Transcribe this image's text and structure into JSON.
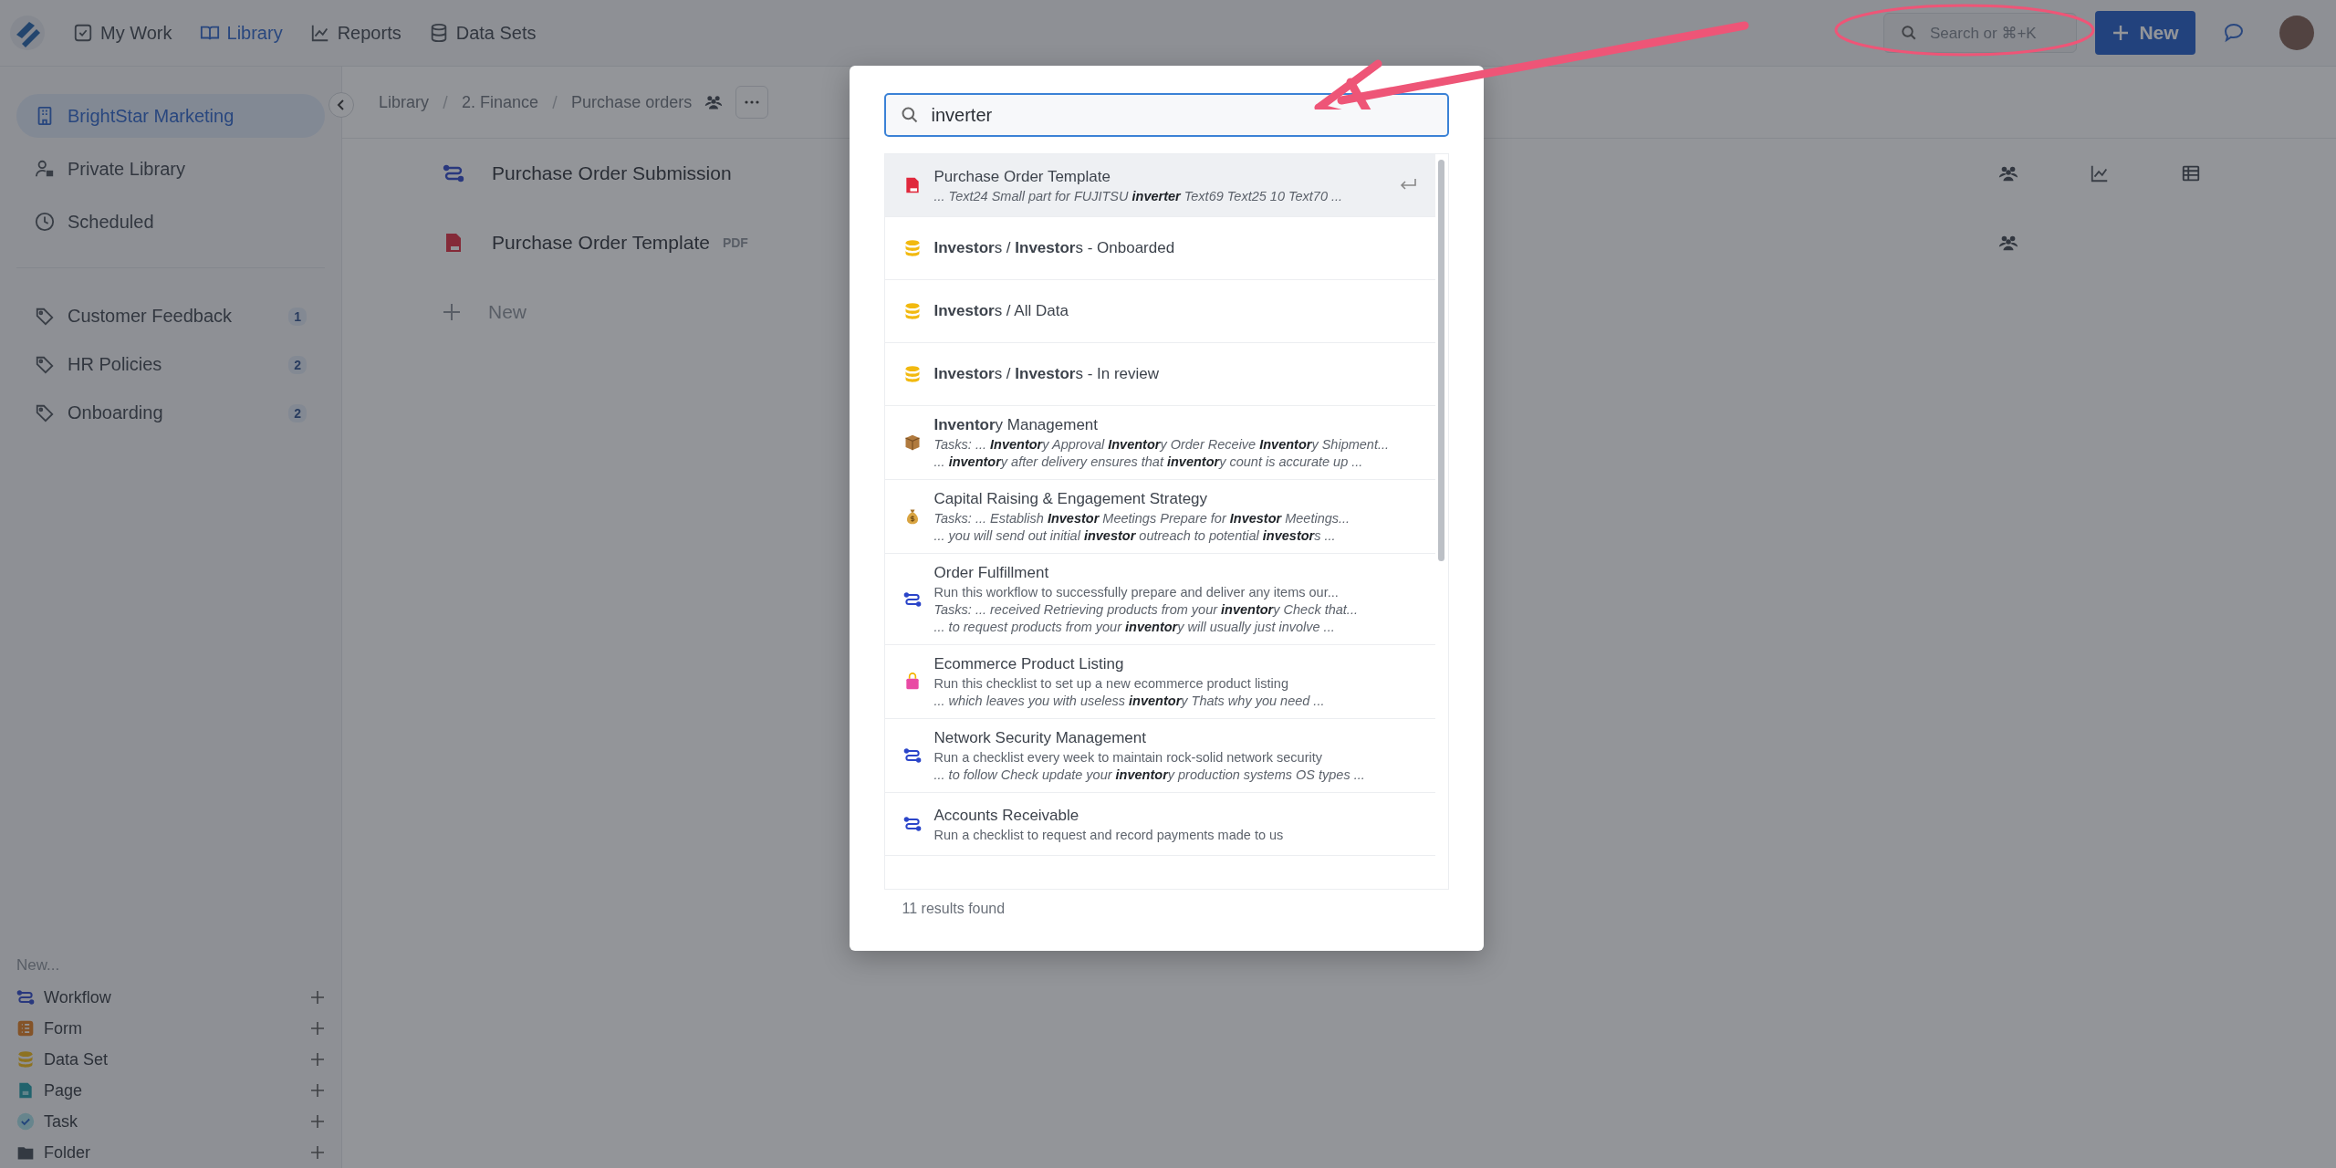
{
  "topnav": {
    "items": [
      {
        "label": "My Work",
        "kind": "check",
        "selected": false
      },
      {
        "label": "Library",
        "kind": "book",
        "selected": true
      },
      {
        "label": "Reports",
        "kind": "chart",
        "selected": false
      },
      {
        "label": "Data Sets",
        "kind": "database",
        "selected": false
      }
    ],
    "search": {
      "placeholder": "Search or ⌘+K"
    },
    "new_button": "New"
  },
  "sidebar": {
    "items": [
      {
        "label": "BrightStar Marketing",
        "kind": "building",
        "selected": true
      },
      {
        "label": "Private Library",
        "kind": "user",
        "selected": false
      },
      {
        "label": "Scheduled",
        "kind": "clock",
        "selected": false
      }
    ],
    "tags": [
      {
        "label": "Customer Feedback",
        "count": "1"
      },
      {
        "label": "HR Policies",
        "count": "2"
      },
      {
        "label": "Onboarding",
        "count": "2"
      }
    ],
    "new_section": {
      "title": "New...",
      "items": [
        {
          "label": "Workflow",
          "kind": "workflow"
        },
        {
          "label": "Form",
          "kind": "form"
        },
        {
          "label": "Data Set",
          "kind": "dataset"
        },
        {
          "label": "Page",
          "kind": "page"
        },
        {
          "label": "Task",
          "kind": "task"
        },
        {
          "label": "Folder",
          "kind": "folder"
        }
      ]
    }
  },
  "breadcrumb": [
    "Library",
    "2. Finance",
    "Purchase orders"
  ],
  "rows": [
    {
      "title": "Purchase Order Submission",
      "kind": "workflow",
      "actions": [
        {
          "kind": "shared"
        },
        {
          "kind": "chart"
        },
        {
          "kind": "table"
        }
      ]
    },
    {
      "title": "Purchase Order Template",
      "kind": "pdf",
      "badge": "PDF",
      "actions": [
        {
          "kind": "shared"
        }
      ]
    }
  ],
  "new_row": "New",
  "search_modal": {
    "query": "inverter",
    "results": [
      {
        "kind": "pdf",
        "selected": true,
        "title": "Purchase Order Template",
        "lines": [
          {
            "kind": "snippet",
            "text": "... Text24 Small part for FUJITSU **inverter** Text69 Text25 10 Text70 ..."
          }
        ]
      },
      {
        "kind": "dataset",
        "selected": false,
        "title": "**Investor**s / **Investor**s - Onboarded"
      },
      {
        "kind": "dataset",
        "selected": false,
        "title": "**Investor**s / All Data"
      },
      {
        "kind": "dataset",
        "selected": false,
        "title": "**Investor**s / **Investor**s - In review"
      },
      {
        "kind": "box",
        "selected": false,
        "title": "**Inventor**y Management",
        "lines": [
          {
            "kind": "snippet",
            "text": "Tasks: ... **Inventor**y Approval **Inventor**y Order Receive **Inventor**y Shipment..."
          },
          {
            "kind": "snippet",
            "text": "... **inventor**y after delivery ensures that **inventor**y count is accurate up ..."
          }
        ]
      },
      {
        "kind": "moneybag",
        "selected": false,
        "title": "Capital Raising & Engagement Strategy",
        "lines": [
          {
            "kind": "snippet",
            "text": "Tasks: ... Establish **Investor** Meetings Prepare for **Investor** Meetings..."
          },
          {
            "kind": "snippet",
            "text": "... you will send out initial **investor** outreach to potential **investor**s ..."
          }
        ]
      },
      {
        "kind": "workflow",
        "selected": false,
        "title": "Order Fulfillment",
        "lines": [
          {
            "kind": "description",
            "text": "Run this workflow to successfully prepare and deliver any items our..."
          },
          {
            "kind": "snippet",
            "text": "Tasks: ... received Retrieving products from your **inventor**y Check that..."
          },
          {
            "kind": "snippet",
            "text": "... to request products from your **inventor**y will usually just involve ..."
          }
        ]
      },
      {
        "kind": "bag",
        "selected": false,
        "title": "Ecommerce Product Listing",
        "lines": [
          {
            "kind": "description",
            "text": "Run this checklist to set up a new ecommerce product listing"
          },
          {
            "kind": "snippet",
            "text": "... which leaves you with useless **inventor**y Thats why you need ..."
          }
        ]
      },
      {
        "kind": "workflow",
        "selected": false,
        "title": "Network Security Management",
        "lines": [
          {
            "kind": "description",
            "text": "Run a checklist every week to maintain rock-solid network security"
          },
          {
            "kind": "snippet",
            "text": "... to follow Check update your **inventor**y production systems OS types ..."
          }
        ]
      },
      {
        "kind": "workflow",
        "selected": false,
        "title": "Accounts Receivable",
        "lines": [
          {
            "kind": "description",
            "text": "Run a checklist to request and record payments made to us"
          }
        ]
      }
    ],
    "footer": "11 results found"
  }
}
